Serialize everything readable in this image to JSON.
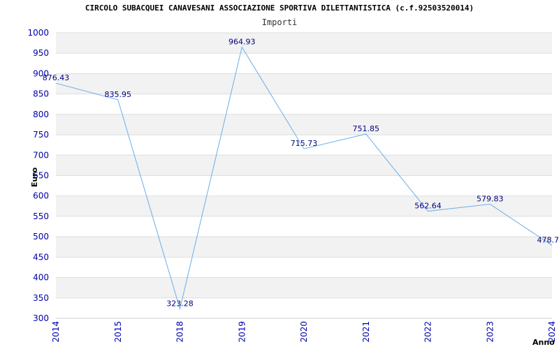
{
  "title": "CIRCOLO SUBACQUEI CANAVESANI ASSOCIAZIONE SPORTIVA DILETTANTISTICA (c.f.92503520014)",
  "subtitle": "Importi",
  "chart_data": {
    "type": "line",
    "title": "CIRCOLO SUBACQUEI CANAVESANI ASSOCIAZIONE SPORTIVA DILETTANTISTICA (c.f.92503520014)",
    "subtitle": "Importi",
    "xlabel": "Anno",
    "ylabel": "Euro",
    "ylim": [
      300,
      1000
    ],
    "yticks": [
      300,
      350,
      400,
      450,
      500,
      550,
      600,
      650,
      700,
      750,
      800,
      850,
      900,
      950,
      1000
    ],
    "categories": [
      "2014",
      "2015",
      "2018",
      "2019",
      "2020",
      "2021",
      "2022",
      "2023",
      "2024"
    ],
    "values": [
      876.43,
      835.95,
      323.28,
      964.93,
      715.73,
      751.85,
      562.64,
      579.83,
      478.7
    ],
    "data_labels": [
      "876.43",
      "835.95",
      "323.28",
      "964.93",
      "715.73",
      "751.85",
      "562.64",
      "579.83",
      "478.7"
    ],
    "grid": true,
    "colors": {
      "line": "#6aaee8",
      "axis_text": "#0000aa",
      "label_text": "#000080",
      "band": "#f2f2f2",
      "grid": "#dddddd"
    }
  }
}
